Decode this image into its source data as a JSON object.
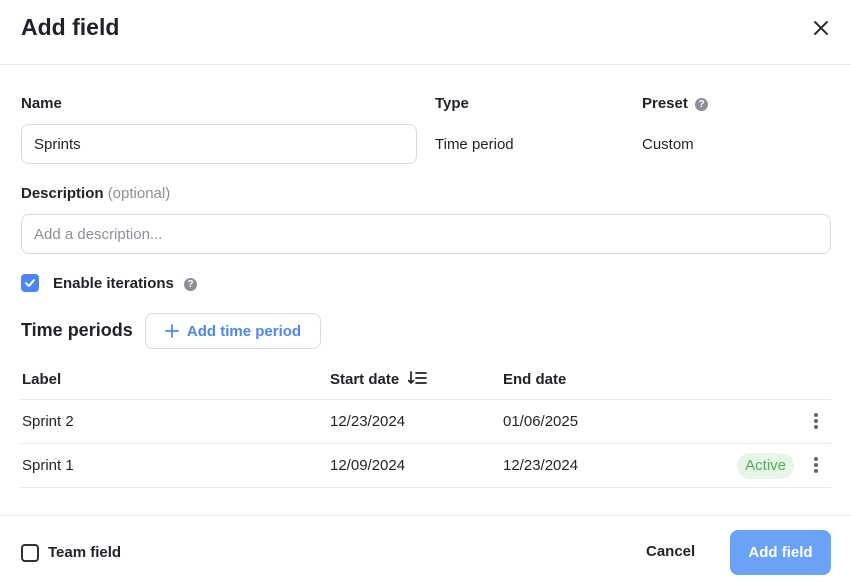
{
  "dialog": {
    "title": "Add field"
  },
  "form": {
    "name_label": "Name",
    "name_value": "Sprints",
    "type_label": "Type",
    "type_value": "Time period",
    "preset_label": "Preset",
    "preset_value": "Custom",
    "description_label": "Description",
    "description_optional": "(optional)",
    "description_placeholder": "Add a description...",
    "enable_iterations_label": "Enable iterations",
    "enable_iterations_checked": true
  },
  "time_periods": {
    "heading": "Time periods",
    "add_button_label": "Add time period",
    "columns": [
      "Label",
      "Start date",
      "End date"
    ],
    "rows": [
      {
        "label": "Sprint 2",
        "start": "12/23/2024",
        "end": "01/06/2025",
        "badge": ""
      },
      {
        "label": "Sprint 1",
        "start": "12/09/2024",
        "end": "12/23/2024",
        "badge": "Active"
      }
    ]
  },
  "footer": {
    "team_field_label": "Team field",
    "team_field_checked": false,
    "cancel_label": "Cancel",
    "submit_label": "Add field"
  },
  "colors": {
    "accent": "#4a86f7",
    "primary_button": "#6aa2f8",
    "active_badge_bg": "#e6f5e6",
    "active_badge_text": "#4fae5c"
  },
  "icons": {
    "close": "close-icon",
    "help": "help-icon",
    "check": "check-icon",
    "plus": "plus-icon",
    "sort": "sort-descending-icon",
    "more": "kebab-icon"
  }
}
